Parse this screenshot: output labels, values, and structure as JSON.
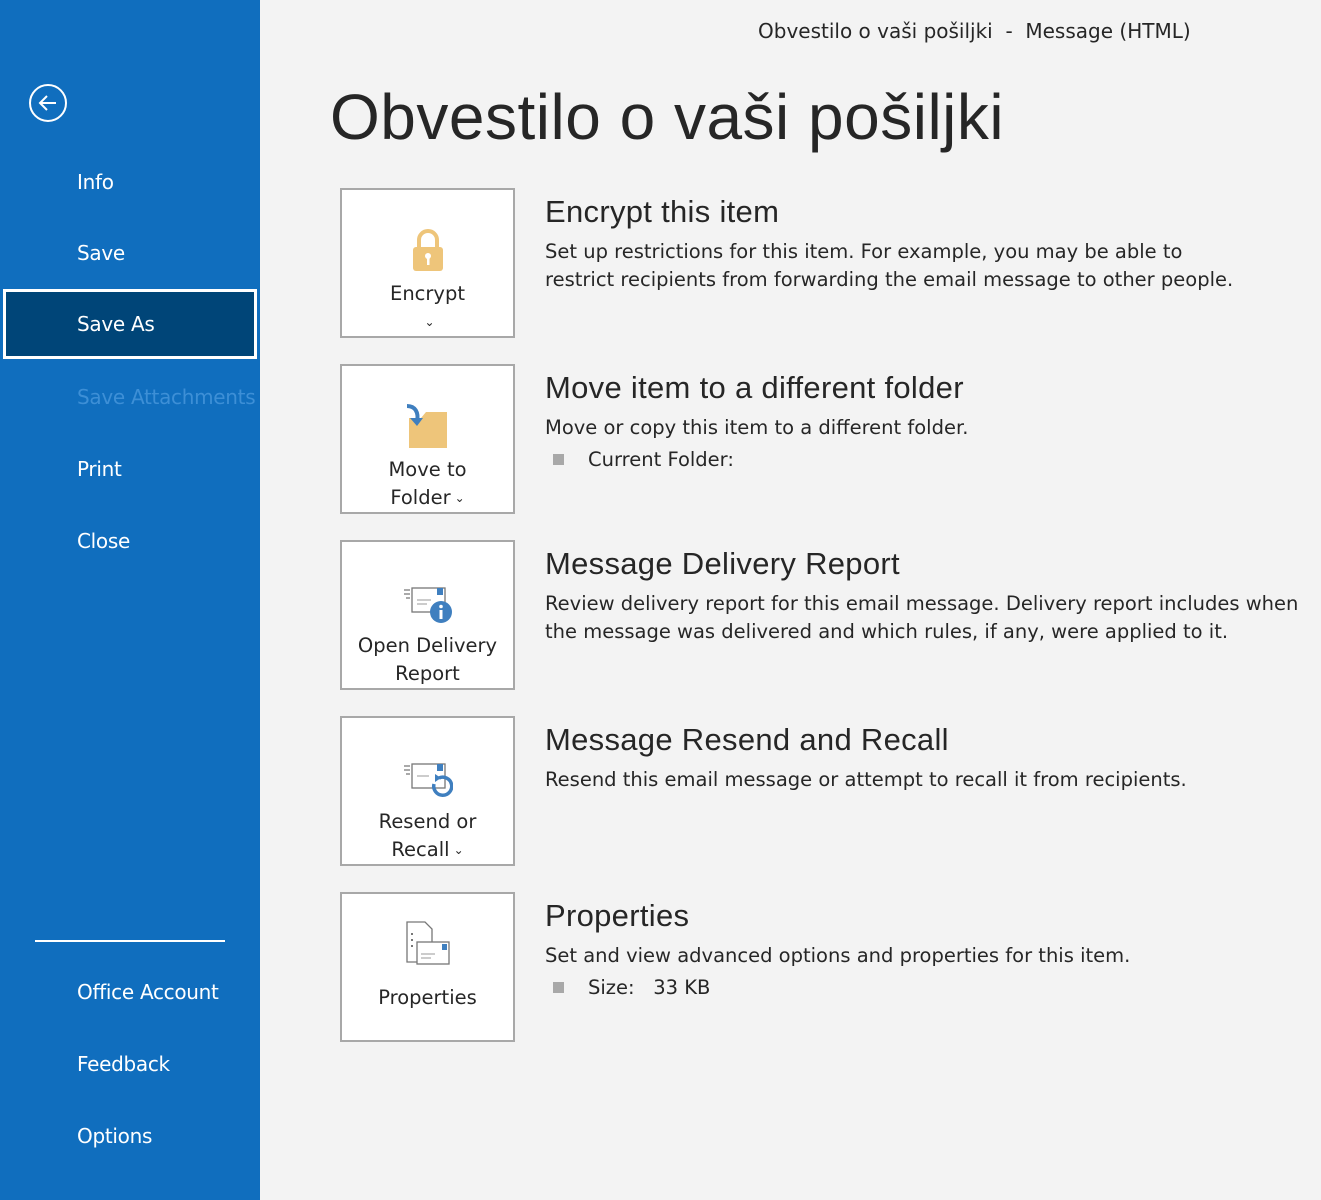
{
  "window_title": "Obvestilo o vaši pošiljki  -  Message (HTML)",
  "page_title": "Obvestilo o vaši pošiljki",
  "sidebar": {
    "back_icon": "arrow-left-circle-icon",
    "items": [
      {
        "label": "Info"
      },
      {
        "label": "Save"
      },
      {
        "label": "Save As",
        "selected": true
      },
      {
        "label": "Save Attachments",
        "disabled": true
      },
      {
        "label": "Print"
      },
      {
        "label": "Close"
      },
      {
        "label": "Office Account"
      },
      {
        "label": "Feedback"
      },
      {
        "label": "Options"
      }
    ],
    "colors": {
      "background": "#106ebe",
      "selected": "#004578"
    }
  },
  "sections": [
    {
      "button": "Encrypt",
      "heading": "Encrypt this item",
      "desc": "Set up restrictions for this item. For example, you may be able to restrict recipients from forwarding the email message to other people.",
      "icon": "lock-icon"
    },
    {
      "button_line1": "Move to",
      "button_line2": "Folder",
      "heading": "Move item to a different folder",
      "desc": "Move or copy this item to a different folder.",
      "bullet_label": "Current Folder:",
      "icon": "move-folder-icon"
    },
    {
      "button_line1": "Open Delivery",
      "button_line2": "Report",
      "heading": "Message Delivery Report",
      "desc": "Review delivery report for this email message. Delivery report includes when the message was delivered and which rules, if any, were applied to it.",
      "icon": "delivery-report-icon"
    },
    {
      "button_line1": "Resend or",
      "button_line2": "Recall",
      "heading": "Message Resend and Recall",
      "desc": "Resend this email message or attempt to recall it from recipients.",
      "icon": "resend-recall-icon"
    },
    {
      "button": "Properties",
      "heading": "Properties",
      "desc": "Set and view advanced options and properties for this item.",
      "bullet_label": "Size:",
      "bullet_value": "33 KB",
      "icon": "properties-icon"
    }
  ]
}
